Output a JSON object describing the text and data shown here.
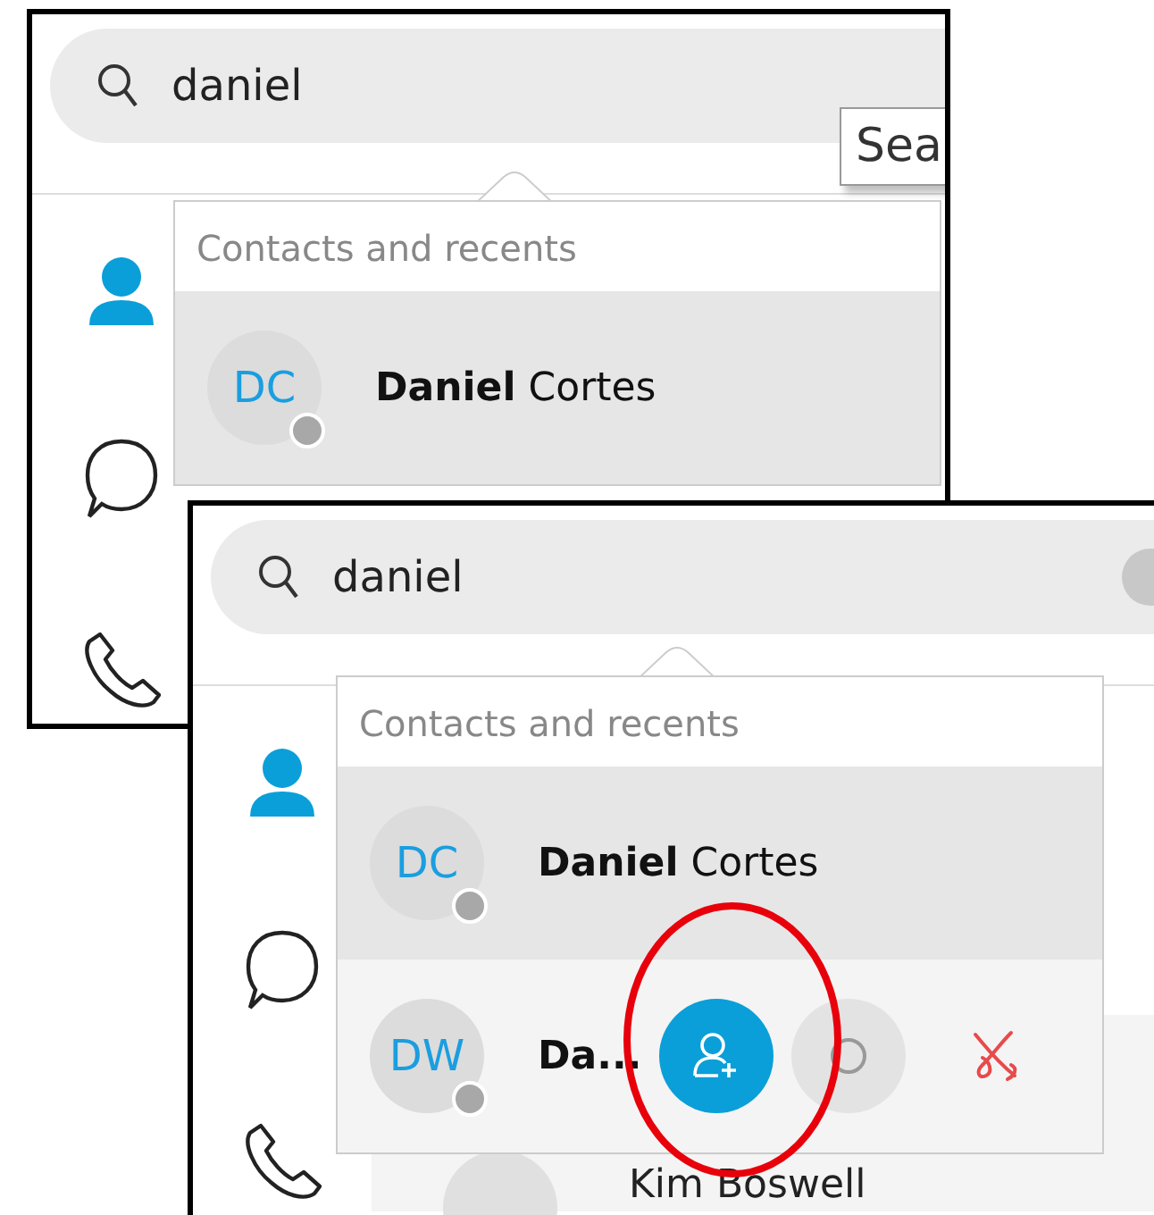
{
  "panels": [
    {
      "search": {
        "value": "daniel"
      },
      "tooltip": "Sea",
      "sidebar": [
        {
          "kind": "contacts",
          "selected": true
        },
        {
          "kind": "chats",
          "selected": false
        },
        {
          "kind": "calls",
          "selected": false
        }
      ],
      "popup": {
        "header": "Contacts and recents",
        "results": [
          {
            "initials": "DC",
            "name": "**Daniel** Cortes",
            "selected": true
          }
        ]
      }
    },
    {
      "search": {
        "value": "daniel"
      },
      "sidebar": [
        {
          "kind": "contacts",
          "selected": true
        },
        {
          "kind": "chats",
          "selected": false
        },
        {
          "kind": "calls",
          "selected": false
        }
      ],
      "contacts": [
        {
          "name": "Kim Boswell"
        }
      ],
      "popup": {
        "header": "Contacts and recents",
        "results": [
          {
            "initials": "DC",
            "name": "**Daniel** Cortes",
            "selected": true
          },
          {
            "initials": "DW",
            "name": "**Da...**",
            "selected": false,
            "actions": [
              {
                "kind": "add-contact"
              },
              {
                "kind": "chat"
              },
              {
                "kind": "end-call"
              }
            ]
          }
        ]
      }
    }
  ]
}
